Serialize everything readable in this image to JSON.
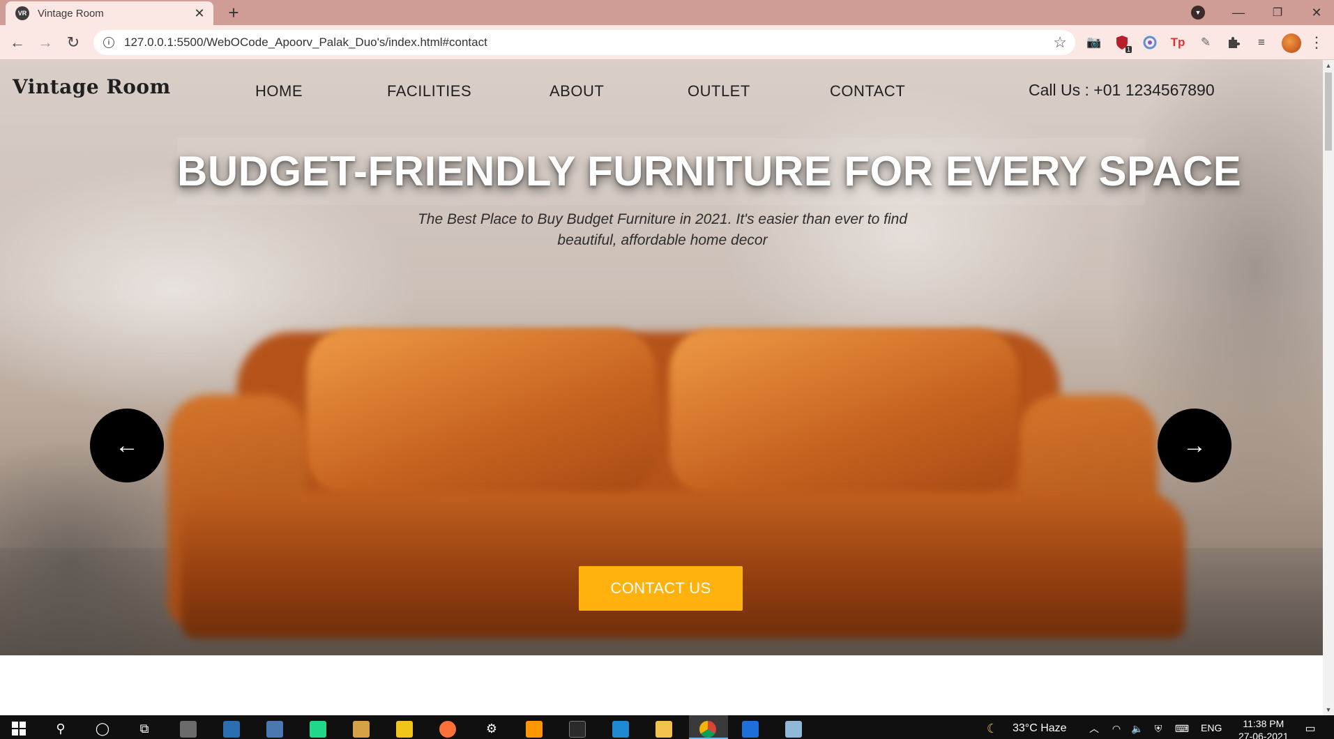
{
  "browser": {
    "tab_title": "Vintage Room",
    "tab_favicon_text": "VR",
    "tab_close": "✕",
    "new_tab": "+",
    "url": "127.0.0.1:5500/WebOCode_Apoorv_Palak_Duo's/index.html#contact",
    "window_minimize": "—",
    "window_restore": "❐",
    "window_close": "✕",
    "back": "←",
    "forward": "→",
    "reload": "↻",
    "star": "☆",
    "ext_badge": "1"
  },
  "site": {
    "logo": "Vintage Room",
    "nav": [
      "HOME",
      "FACILITIES",
      "ABOUT",
      "OUTLET",
      "CONTACT"
    ],
    "call": "Call Us : +01 1234567890"
  },
  "hero": {
    "title": "BUDGET-FRIENDLY FURNITURE FOR EVERY SPACE",
    "subtitle": "The Best Place to Buy Budget Furniture in 2021. It's easier than ever to find beautiful, affordable home decor",
    "prev": "←",
    "next": "→",
    "cta": "CONTACT US"
  },
  "taskbar": {
    "weather": "33°C  Haze",
    "lang": "ENG",
    "time": "11:38 PM",
    "date": "27-06-2021"
  },
  "colors": {
    "tabstrip": "#cf9d95",
    "toolbar": "#fbe7e3",
    "cta": "#ffb20d"
  }
}
